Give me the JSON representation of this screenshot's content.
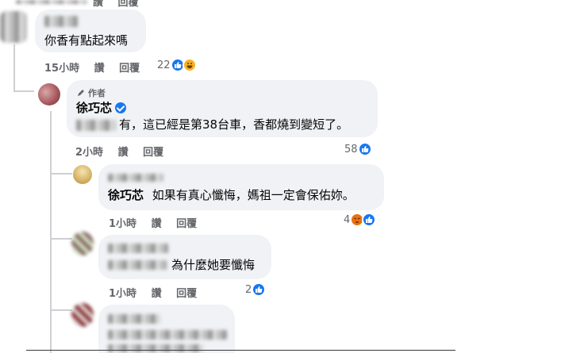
{
  "top_partial": {
    "like_label": "讚",
    "reply_label": "回覆"
  },
  "comments": [
    {
      "text": "你香有點起來嗎",
      "time": "15小時",
      "like_label": "讚",
      "reply_label": "回覆",
      "reaction_count": "22"
    },
    {
      "author_tag": "作者",
      "author_name": "徐巧芯",
      "text": "有，這已經是第38台車，香都燒到變短了。",
      "time": "2小時",
      "like_label": "讚",
      "reply_label": "回覆",
      "reaction_count": "58"
    },
    {
      "mention": "徐巧芯",
      "text": "如果有真心懺悔，媽祖一定會保佑妳。",
      "time": "1小時",
      "like_label": "讚",
      "reply_label": "回覆",
      "reaction_count": "4"
    },
    {
      "text": "為什麼她要懺悔",
      "time": "1小時",
      "like_label": "讚",
      "reply_label": "回覆",
      "reaction_count": "2"
    }
  ],
  "colors": {
    "like": "#1877f2",
    "haha": "#f7b125",
    "angry": "#e9710f",
    "bubble": "#f0f2f5",
    "meta": "#65676b"
  },
  "icons": [
    "like-icon",
    "haha-icon",
    "angry-icon",
    "verified-icon",
    "pencil-icon"
  ]
}
